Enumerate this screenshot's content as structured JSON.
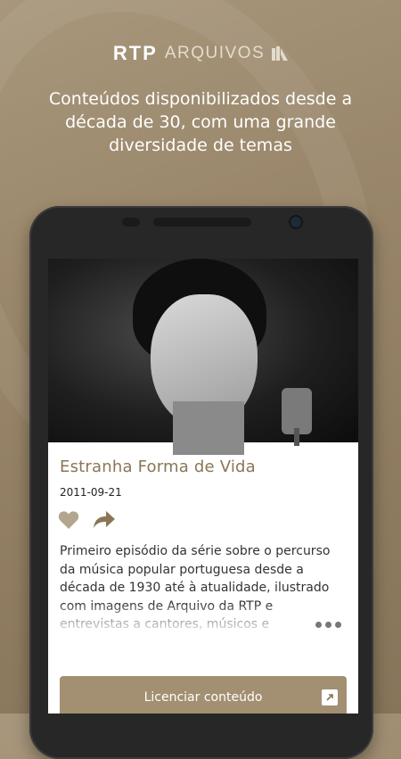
{
  "brand": {
    "logo_main": "RTP",
    "logo_sub": "ARQUIVOS"
  },
  "tagline": "Conteúdos disponibilizados desde a década de 30, com uma grande diversidade de temas",
  "content": {
    "title": "Estranha Forma de Vida",
    "date": "2011-09-21",
    "description": "Primeiro episódio da série sobre o percurso da música popular portuguesa desde a década de 1930 até à atualidade, ilustrado com imagens de Arquivo da RTP e entrevistas a cantores, músicos e",
    "license_button": "Licenciar conteúdo"
  },
  "icons": {
    "favorite": "heart-icon",
    "share": "share-arrow-icon",
    "more": "more-dots-icon",
    "external": "external-link-icon"
  },
  "colors": {
    "accent": "#8a7656",
    "button": "#a39072",
    "background": "#9a876b"
  }
}
